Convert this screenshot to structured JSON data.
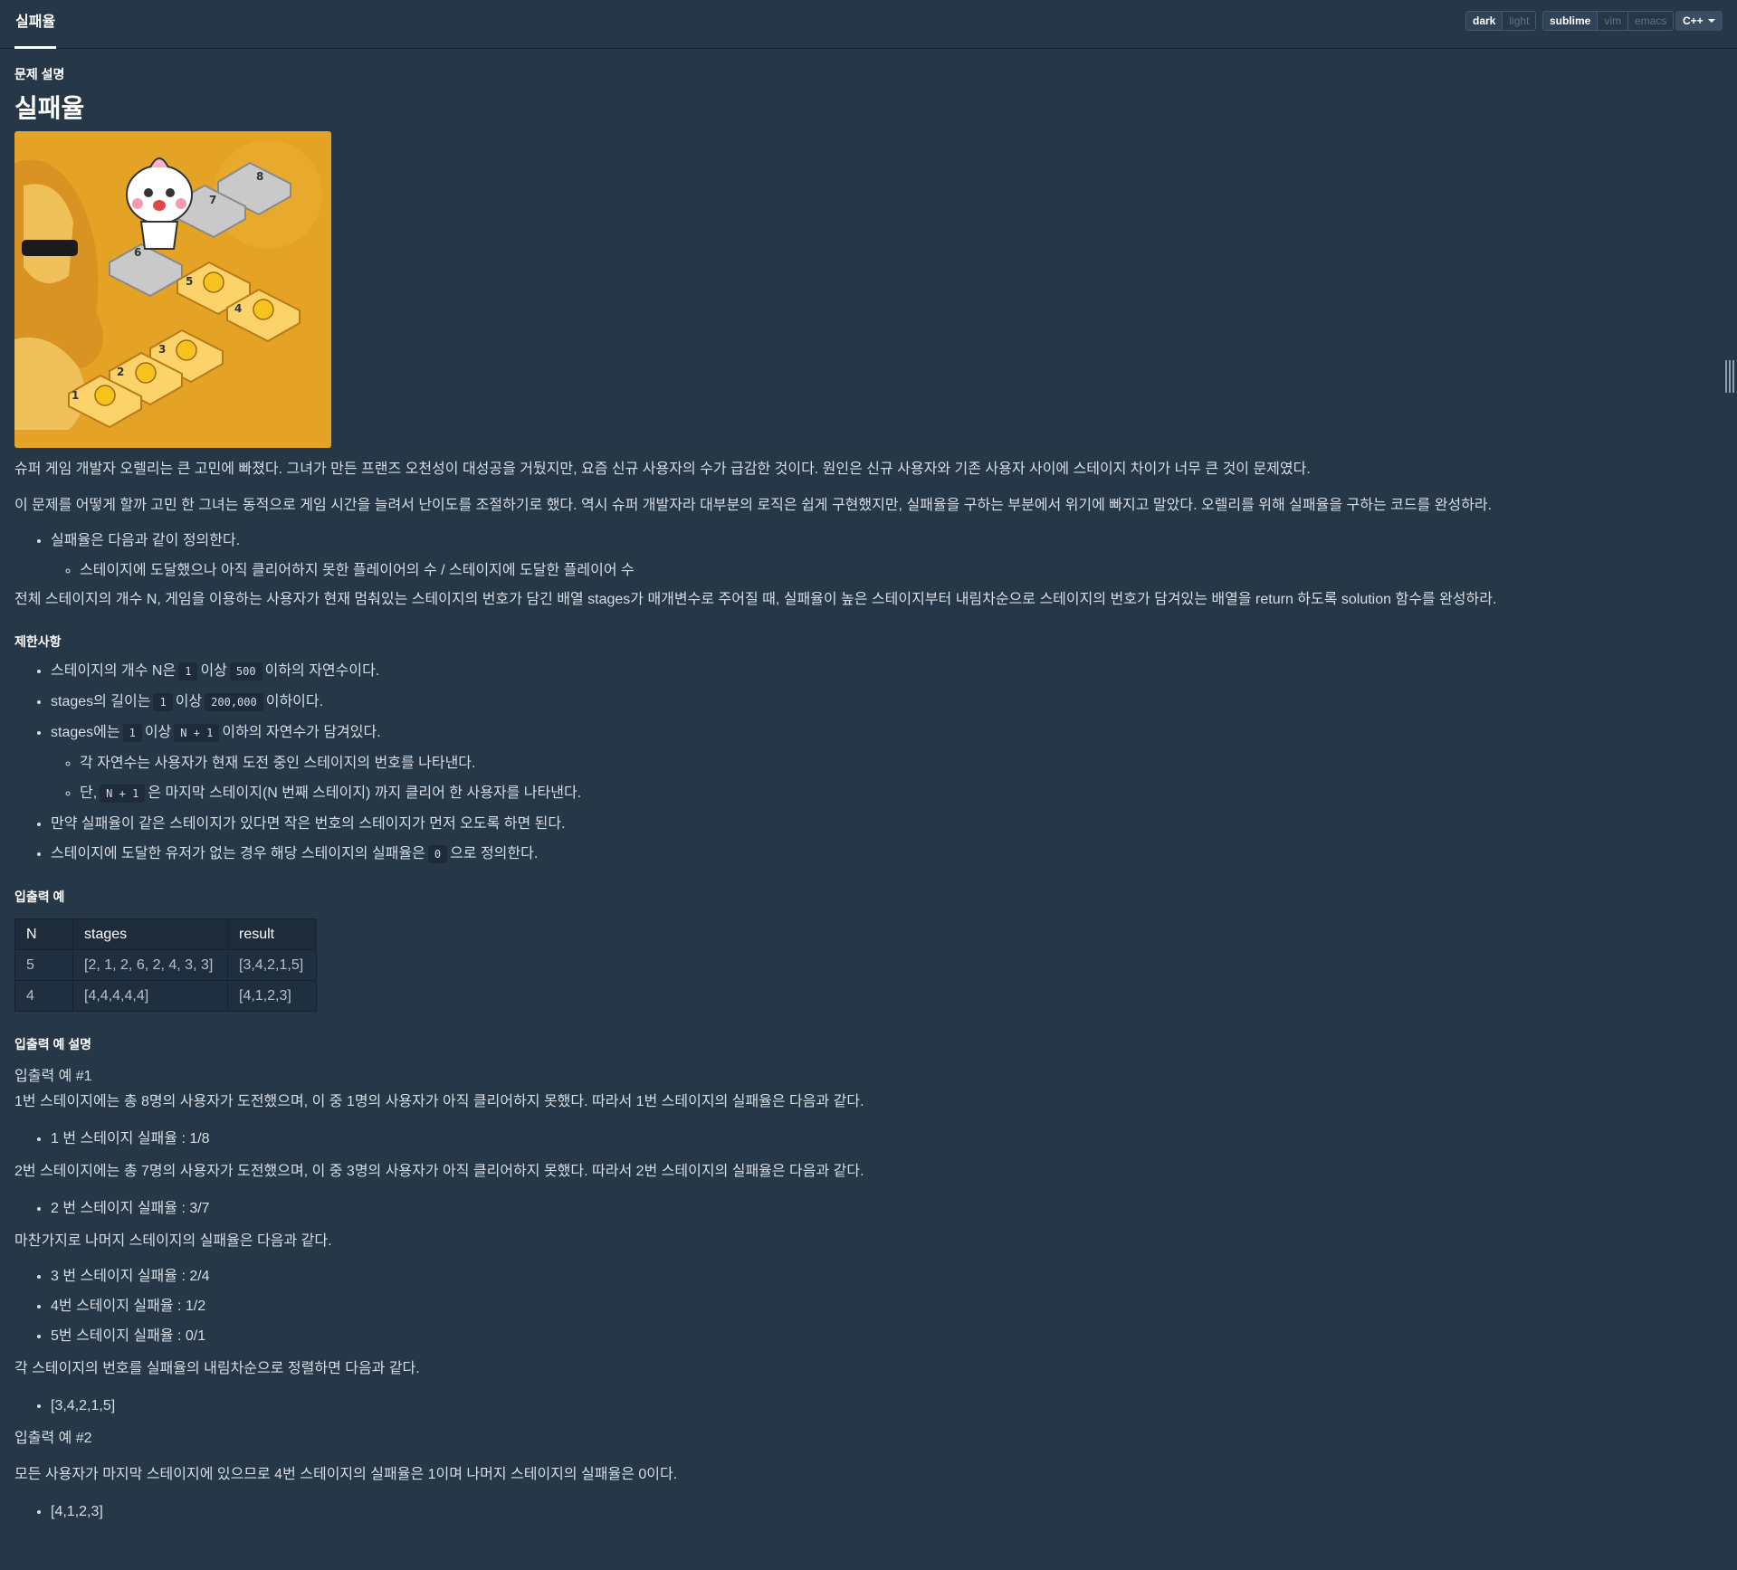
{
  "topbar": {
    "tab_title": "실패율",
    "theme_options": [
      "dark",
      "light"
    ],
    "keymap_options": [
      "sublime",
      "vim",
      "emacs"
    ],
    "language": "C++"
  },
  "problem": {
    "section_label": "문제 설명",
    "title": "실패율",
    "image_icon": "stage-illustration",
    "intro1": "슈퍼 게임 개발자 오렐리는 큰 고민에 빠졌다. 그녀가 만든 프랜즈 오천성이 대성공을 거뒀지만, 요즘 신규 사용자의 수가 급감한 것이다. 원인은 신규 사용자와 기존 사용자 사이에 스테이지 차이가 너무 큰 것이 문제였다.",
    "intro2": "이 문제를 어떻게 할까 고민 한 그녀는 동적으로 게임 시간을 늘려서 난이도를 조절하기로 했다. 역시 슈퍼 개발자라 대부분의 로직은 쉽게 구현했지만, 실패율을 구하는 부분에서 위기에 빠지고 말았다. 오렐리를 위해 실패율을 구하는 코드를 완성하라.",
    "definition": "실패율은 다음과 같이 정의한다.",
    "definition_formula": "스테이지에 도달했으나 아직 클리어하지 못한 플레이어의 수 / 스테이지에 도달한 플레이어 수",
    "task": "전체 스테이지의 개수 N, 게임을 이용하는 사용자가 현재 멈춰있는 스테이지의 번호가 담긴 배열 stages가 매개변수로 주어질 때, 실패율이 높은 스테이지부터 내림차순으로 스테이지의 번호가 담겨있는 배열을 return 하도록 solution 함수를 완성하라."
  },
  "constraints": {
    "heading": "제한사항",
    "c1": {
      "a": "스테이지의 개수 N은",
      "code1": "1",
      "b": "이상",
      "code2": "500",
      "c": "이하의 자연수이다."
    },
    "c2": {
      "a": "stages의 길이는",
      "code1": "1",
      "b": "이상",
      "code2": "200,000",
      "c": "이하이다."
    },
    "c3": {
      "a": "stages에는",
      "code1": "1",
      "b": "이상",
      "code2": "N + 1",
      "c": "이하의 자연수가 담겨있다."
    },
    "c3_sub1": "각 자연수는 사용자가 현재 도전 중인 스테이지의 번호를 나타낸다.",
    "c3_sub2": {
      "a": "단,",
      "code": "N + 1",
      "b": "은 마지막 스테이지(N 번째 스테이지) 까지 클리어 한 사용자를 나타낸다."
    },
    "c4": "만약 실패율이 같은 스테이지가 있다면 작은 번호의 스테이지가 먼저 오도록 하면 된다.",
    "c5": {
      "a": "스테이지에 도달한 유저가 없는 경우 해당 스테이지의 실패율은",
      "code": "0",
      "b": "으로 정의한다."
    }
  },
  "examples": {
    "heading": "입출력 예",
    "headers": [
      "N",
      "stages",
      "result"
    ],
    "rows": [
      [
        "5",
        "[2, 1, 2, 6, 2, 4, 3, 3]",
        "[3,4,2,1,5]"
      ],
      [
        "4",
        "[4,4,4,4,4]",
        "[4,1,2,3]"
      ]
    ]
  },
  "explanation": {
    "heading": "입출력 예 설명",
    "ex1_title": "입출력 예 #1",
    "ex1_p1": "1번 스테이지에는 총 8명의 사용자가 도전했으며, 이 중 1명의 사용자가 아직 클리어하지 못했다. 따라서 1번 스테이지의 실패율은 다음과 같다.",
    "ex1_li1": "1 번 스테이지 실패율 : 1/8",
    "ex1_p2": "2번 스테이지에는 총 7명의 사용자가 도전했으며, 이 중 3명의 사용자가 아직 클리어하지 못했다. 따라서 2번 스테이지의 실패율은 다음과 같다.",
    "ex1_li2": "2 번 스테이지 실패율 : 3/7",
    "ex1_p3": "마찬가지로 나머지 스테이지의 실패율은 다음과 같다.",
    "ex1_li3": [
      "3 번 스테이지 실패율 : 2/4",
      "4번 스테이지 실패율 : 1/2",
      "5번 스테이지 실패율 : 0/1"
    ],
    "ex1_p4": "각 스테이지의 번호를 실패율의 내림차순으로 정렬하면 다음과 같다.",
    "ex1_li4": "[3,4,2,1,5]",
    "ex2_title": "입출력 예 #2",
    "ex2_p1": "모든 사용자가 마지막 스테이지에 있으므로 4번 스테이지의 실패율은 1이며 나머지 스테이지의 실패율은 0이다.",
    "ex2_li1": "[4,1,2,3]"
  }
}
